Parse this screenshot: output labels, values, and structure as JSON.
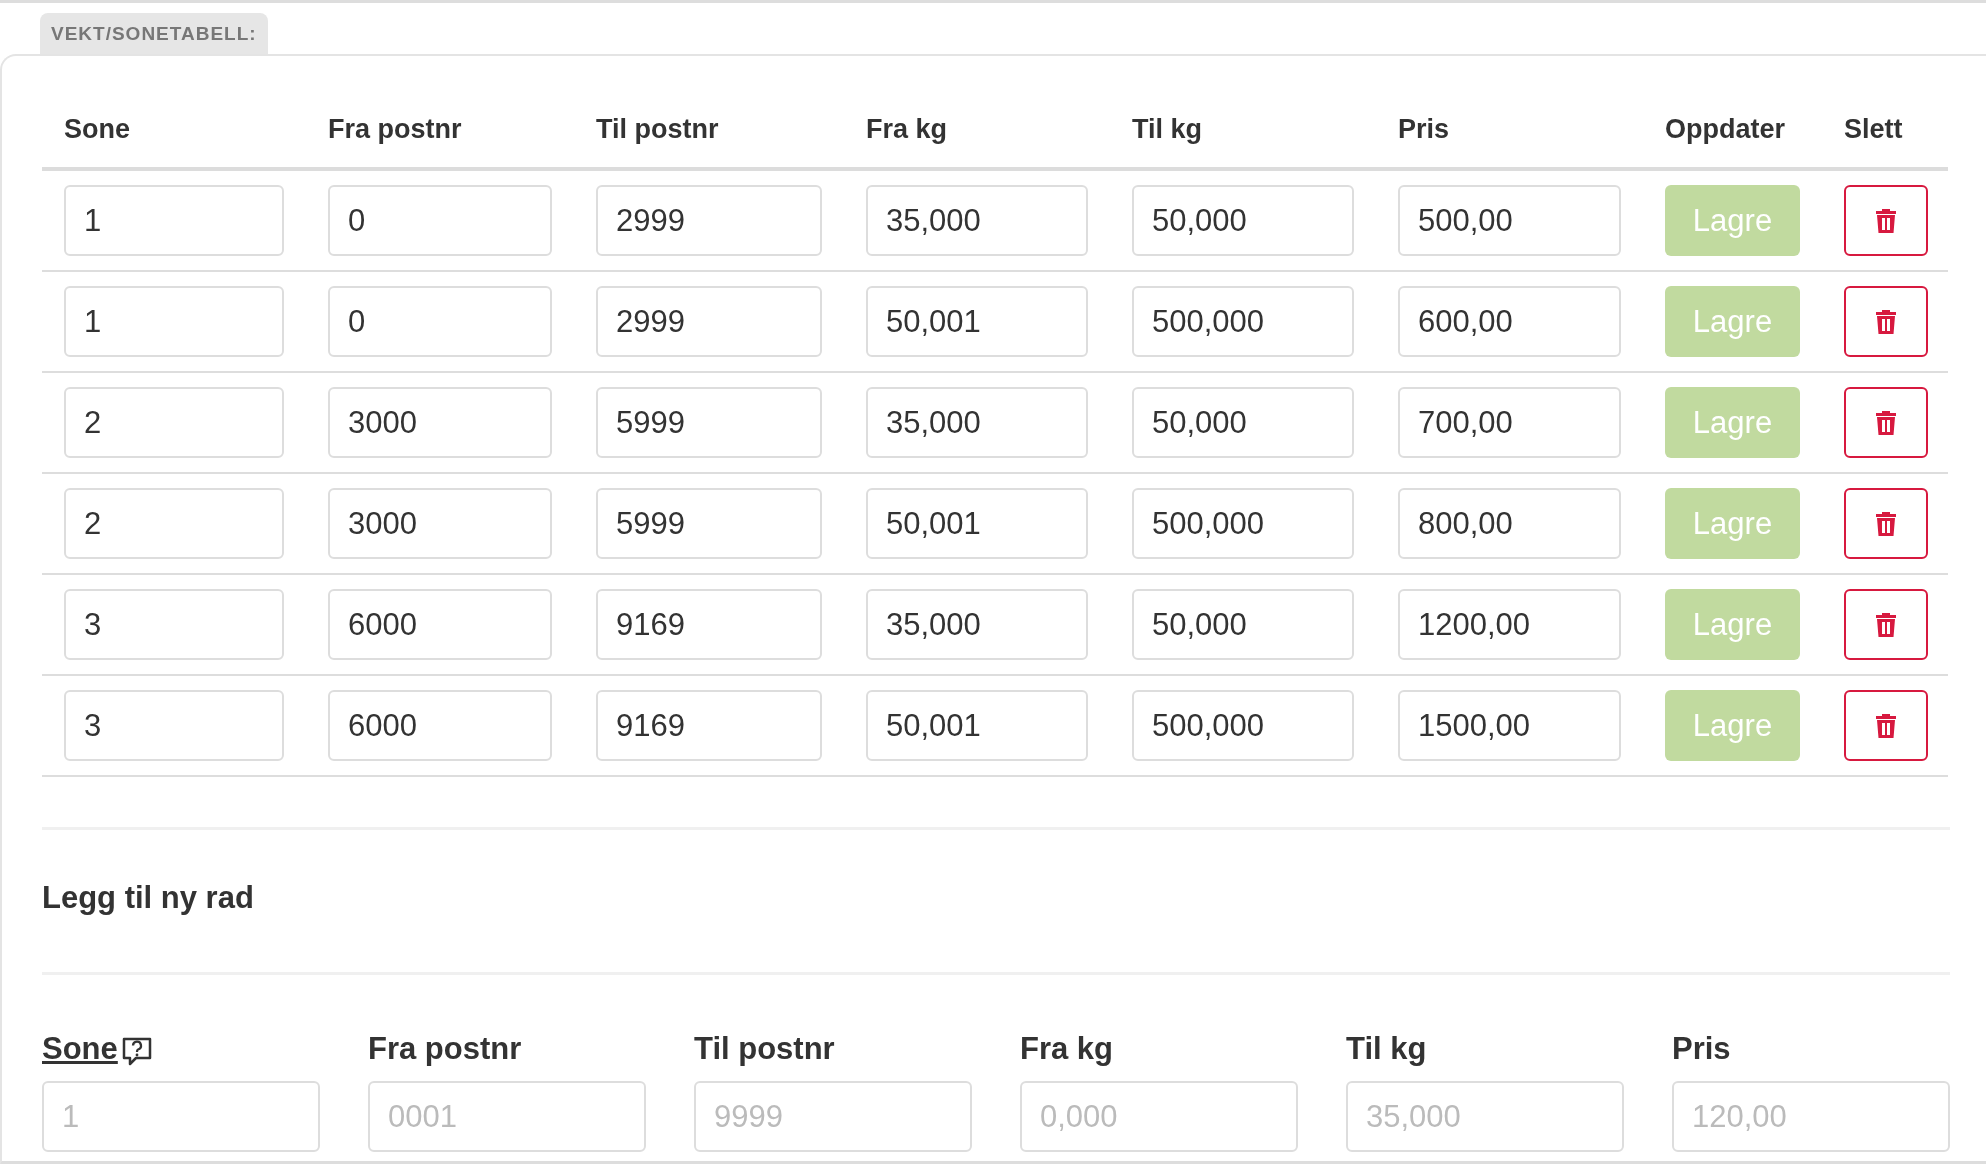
{
  "section_tag": "VEKT/SONETABELL:",
  "table": {
    "columns": [
      "Sone",
      "Fra postnr",
      "Til postnr",
      "Fra kg",
      "Til kg",
      "Pris",
      "Oppdater",
      "Slett"
    ],
    "rows": [
      {
        "values": [
          "1",
          "0",
          "2999",
          "35,000",
          "50,000",
          "500,00"
        ],
        "save_label": "Lagre"
      },
      {
        "values": [
          "1",
          "0",
          "2999",
          "50,001",
          "500,000",
          "600,00"
        ],
        "save_label": "Lagre"
      },
      {
        "values": [
          "2",
          "3000",
          "5999",
          "35,000",
          "50,000",
          "700,00"
        ],
        "save_label": "Lagre"
      },
      {
        "values": [
          "2",
          "3000",
          "5999",
          "50,001",
          "500,000",
          "800,00"
        ],
        "save_label": "Lagre"
      },
      {
        "values": [
          "3",
          "6000",
          "9169",
          "35,000",
          "50,000",
          "1200,00"
        ],
        "save_label": "Lagre"
      },
      {
        "values": [
          "3",
          "6000",
          "9169",
          "50,001",
          "500,000",
          "1500,00"
        ],
        "save_label": "Lagre"
      }
    ]
  },
  "new_row": {
    "title": "Legg til ny rad",
    "fields": [
      {
        "label": "Sone",
        "placeholder": "1",
        "help": true
      },
      {
        "label": "Fra postnr",
        "placeholder": "0001",
        "help": false
      },
      {
        "label": "Til postnr",
        "placeholder": "9999",
        "help": false
      },
      {
        "label": "Fra kg",
        "placeholder": "0,000",
        "help": false
      },
      {
        "label": "Til kg",
        "placeholder": "35,000",
        "help": false
      },
      {
        "label": "Pris",
        "placeholder": "120,00",
        "help": false
      }
    ]
  }
}
